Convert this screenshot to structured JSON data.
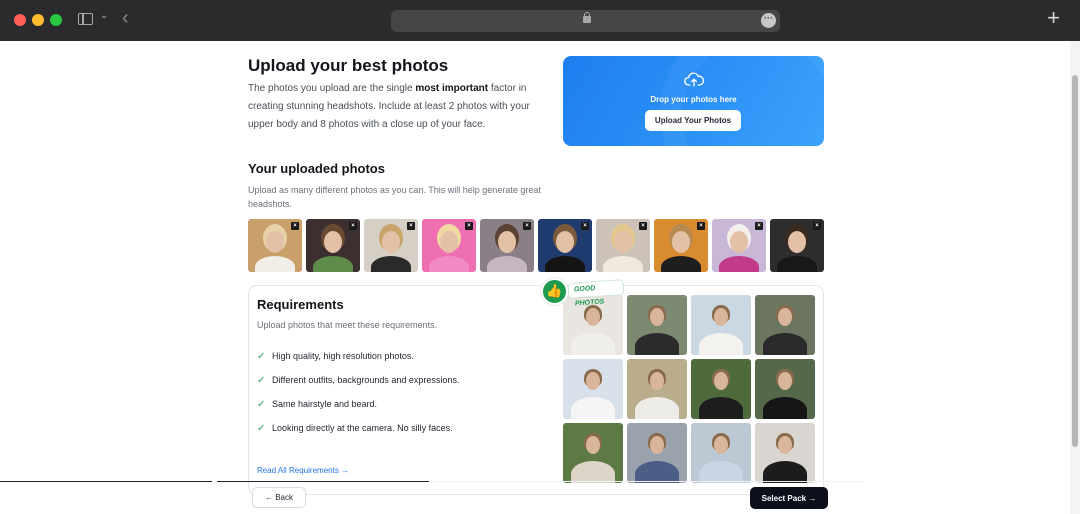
{
  "browser": {
    "new_tab_label": "+",
    "back_label": "‹",
    "more_label": "···"
  },
  "upload": {
    "title": "Upload your best photos",
    "intro_pre": "The photos you upload are the single ",
    "intro_bold": "most important",
    "intro_post": " factor in creating stunning headshots. Include at least 2 photos with your upper body and 8 photos with a close up of your face.",
    "drop_text": "Drop your photos here",
    "button_label": "Upload Your Photos"
  },
  "uploaded": {
    "title": "Your uploaded photos",
    "description": "Upload as many different photos as you can. This will help generate great headshots.",
    "remove_label": "×",
    "photos": [
      {
        "bg": "#c9a06a",
        "hair": "#e6d2a8",
        "top": "#f1eee8"
      },
      {
        "bg": "#3b2f2f",
        "hair": "#6b4a33",
        "top": "#5f8c4a"
      },
      {
        "bg": "#d6cfc5",
        "hair": "#c8a46a",
        "top": "#2a2a2a"
      },
      {
        "bg": "#ef6fb3",
        "hair": "#f0d9a0",
        "top": "#f28ac3"
      },
      {
        "bg": "#8a7f86",
        "hair": "#5a4234",
        "top": "#c7b6c0"
      },
      {
        "bg": "#203b6e",
        "hair": "#7a5a3a",
        "top": "#141414"
      },
      {
        "bg": "#ccc2b8",
        "hair": "#e2c78f",
        "top": "#efe9e0"
      },
      {
        "bg": "#d98b2f",
        "hair": "#b98a52",
        "top": "#1e1e1e"
      },
      {
        "bg": "#c9b7d8",
        "hair": "#f3f0ec",
        "top": "#c23b8a"
      },
      {
        "bg": "#2d2d2d",
        "hair": "#3a2a20",
        "top": "#181818"
      }
    ]
  },
  "requirements": {
    "title": "Requirements",
    "description": "Upload photos that meet these requirements.",
    "items": [
      "High quality, high resolution photos.",
      "Different outfits, backgrounds and expressions.",
      "Same hairstyle and beard.",
      "Looking directly at the camera. No silly faces."
    ],
    "read_all_label": "Read All Requirements →",
    "badge_label": "GOOD PHOTOS",
    "examples": [
      {
        "bg": "#e9e6e2",
        "top": "#f1efe9"
      },
      {
        "bg": "#7d8a72",
        "top": "#2b2b2b"
      },
      {
        "bg": "#c9d8e3",
        "top": "#f4f2ee"
      },
      {
        "bg": "#6b7560",
        "top": "#2a2a2a"
      },
      {
        "bg": "#d8e1ea",
        "top": "#f5f5f5"
      },
      {
        "bg": "#b9ad8e",
        "top": "#ecebe6"
      },
      {
        "bg": "#4f6a3c",
        "top": "#1e1e1e"
      },
      {
        "bg": "#55684a",
        "top": "#161616"
      },
      {
        "bg": "#5d7a44",
        "top": "#dcd5c8"
      },
      {
        "bg": "#9aa2ab",
        "top": "#4b5f86"
      },
      {
        "bg": "#bcc9d4",
        "top": "#c9d5e4"
      },
      {
        "bg": "#d9d6d2",
        "top": "#1c1c1c"
      }
    ]
  },
  "footer": {
    "back_label": "← Back",
    "select_label": "Select Pack →"
  },
  "colors": {
    "accent": "#2474e5",
    "success": "#1d9a4e",
    "primary_button": "#0c0f1a"
  }
}
